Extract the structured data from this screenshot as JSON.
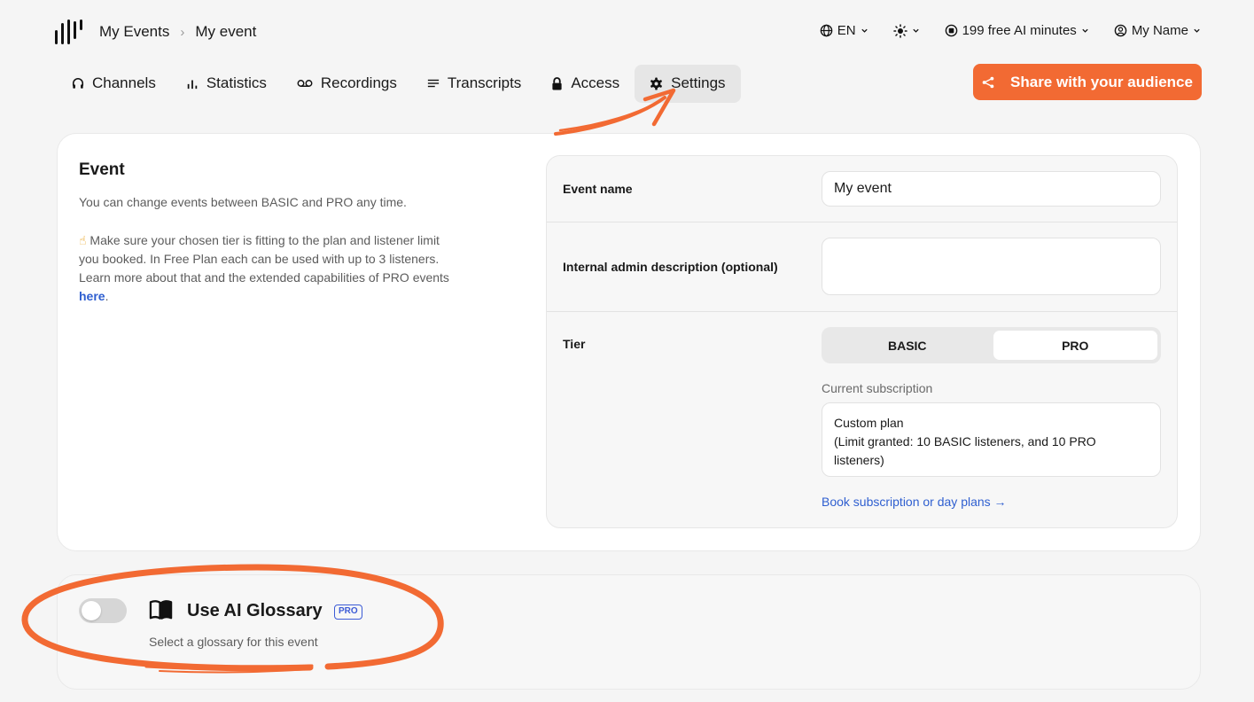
{
  "breadcrumb": {
    "root": "My Events",
    "separator": "›",
    "current": "My event"
  },
  "topbar": {
    "language": "EN",
    "theme_icon": "sun-icon",
    "ai_minutes": "199 free AI minutes",
    "user_name": "My Name"
  },
  "nav": {
    "tabs": [
      {
        "label": "Channels",
        "icon": "headphones-icon"
      },
      {
        "label": "Statistics",
        "icon": "bar-chart-icon"
      },
      {
        "label": "Recordings",
        "icon": "voicemail-icon"
      },
      {
        "label": "Transcripts",
        "icon": "lines-icon"
      },
      {
        "label": "Access",
        "icon": "lock-icon"
      },
      {
        "label": "Settings",
        "icon": "gear-icon",
        "active": true
      }
    ],
    "share_label": "Share with your audience"
  },
  "event": {
    "title": "Event",
    "intro": "You can change events between BASIC and PRO any time.",
    "note_emoji": "☝",
    "note": "Make sure your chosen tier is fitting to the plan and listener limit you booked. In Free Plan each can be used with up to 3 listeners.",
    "learn_more": "Learn more about that and the extended capabilities of PRO events",
    "here_link": "here",
    "period": ".",
    "name_label": "Event name",
    "name_value": "My event",
    "desc_label": "Internal admin description (optional)",
    "desc_value": "",
    "tier_label": "Tier",
    "tier_options": [
      "BASIC",
      "PRO"
    ],
    "tier_selected": "PRO",
    "subscription_label": "Current subscription",
    "subscription_line1": "Custom plan",
    "subscription_line2": "(Limit granted: 10 BASIC listeners, and 10 PRO listeners)",
    "book_link": "Book subscription or day plans →"
  },
  "glossary": {
    "enabled": false,
    "title": "Use AI Glossary",
    "badge": "PRO",
    "subtitle": "Select a glossary for this event"
  },
  "colors": {
    "accent": "#f26a33",
    "link": "#2f5fd0",
    "badge": "#3c5bd6",
    "annotation": "#f26a33"
  }
}
